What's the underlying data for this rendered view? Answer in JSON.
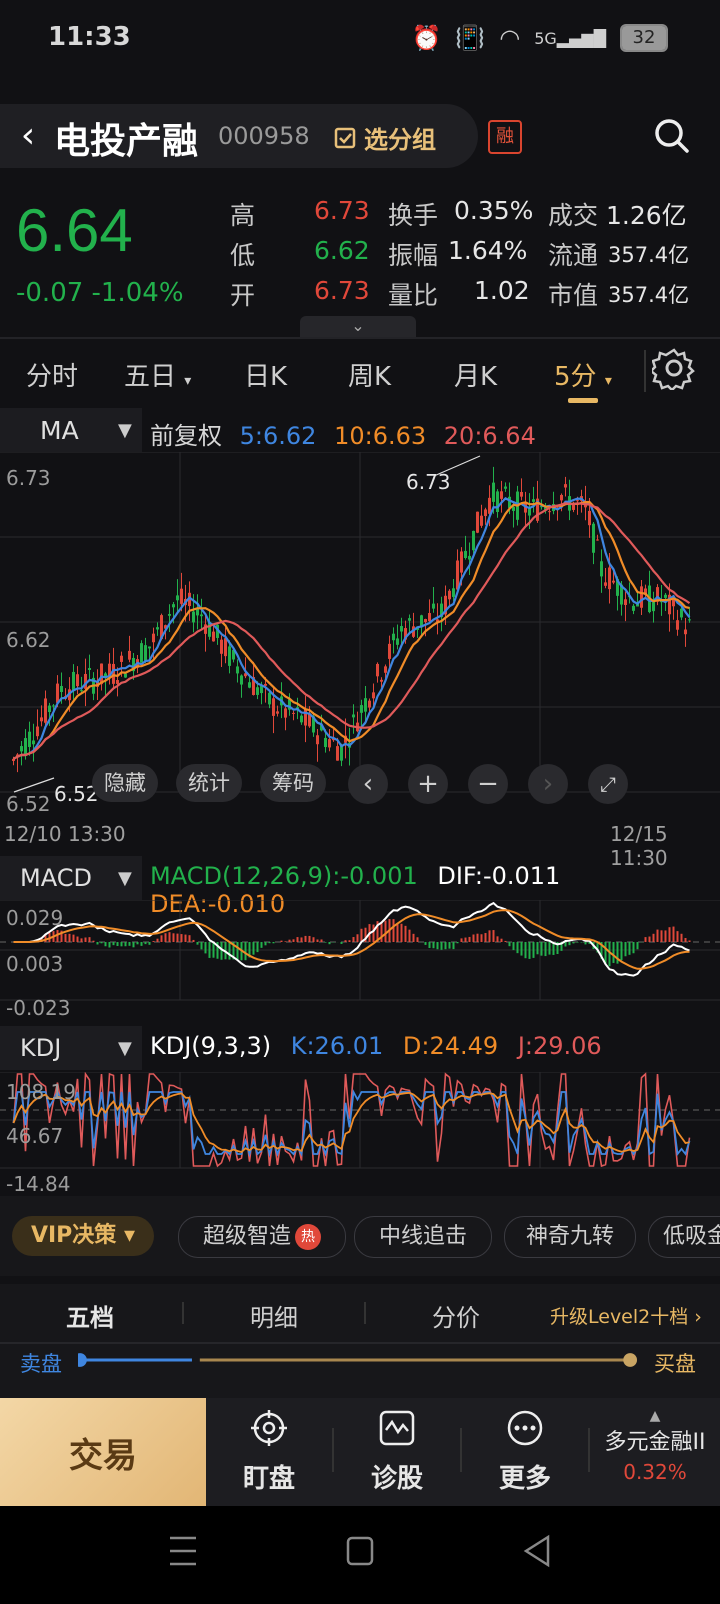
{
  "status_bar": {
    "time": "11:33",
    "network": "5G",
    "battery": "32"
  },
  "header": {
    "back_icon": "back-arrow-icon",
    "name": "电投产融",
    "code": "000958",
    "group_label": "选分组",
    "badge": "融"
  },
  "quote": {
    "price": "6.64",
    "change": "-0.07",
    "change_pct": "-1.04%",
    "rows": [
      [
        {
          "l": "高",
          "v": "6.73",
          "c": "red"
        },
        {
          "l": "换手",
          "v": "0.35%"
        },
        {
          "l": "成交",
          "v": "1.26亿"
        }
      ],
      [
        {
          "l": "低",
          "v": "6.62",
          "c": "green"
        },
        {
          "l": "振幅",
          "v": "1.64%"
        },
        {
          "l": "流通",
          "v": "357.4亿"
        }
      ],
      [
        {
          "l": "开",
          "v": "6.73",
          "c": "red"
        },
        {
          "l": "量比",
          "v": "1.02"
        },
        {
          "l": "市值",
          "v": "357.4亿"
        }
      ]
    ]
  },
  "tabs": [
    "分时",
    "五日",
    "日K",
    "周K",
    "月K",
    "5分"
  ],
  "active_tab": "5分",
  "ma": {
    "selector": "MA",
    "adjust": "前复权",
    "ma5": "5:6.62",
    "ma10": "10:6.63",
    "ma20": "20:6.64"
  },
  "kline": {
    "ymax_label": "6.73",
    "ymid_label": "6.62",
    "ymin_label": "6.52",
    "hi_mark": "6.73",
    "lo_mark": "6.52",
    "start_time": "12/10 13:30",
    "end_time": "12/15 11:30"
  },
  "chart_tools": {
    "hide": "隐藏",
    "stats": "统计",
    "chips": "筹码"
  },
  "macd": {
    "selector": "MACD",
    "title": "MACD(12,26,9):-0.001",
    "dif": "DIF:-0.011",
    "dea": "DEA:-0.010",
    "ymax": "0.029",
    "ymid": "0.003",
    "ymin": "-0.023"
  },
  "kdj": {
    "selector": "KDJ",
    "title": "KDJ(9,3,3)",
    "k": "K:26.01",
    "d": "D:24.49",
    "j": "J:29.06",
    "ymax": "108.19",
    "ymid": "46.67",
    "ymin": "-14.84"
  },
  "features": {
    "vip": "VIP决策",
    "items": [
      "超级智造",
      "中线追击",
      "神奇九转",
      "低吸金"
    ],
    "hot": "热"
  },
  "orderbook": {
    "tabs": [
      "五档",
      "明细",
      "分价"
    ],
    "upgrade": "升级Level2十档",
    "sell": "卖盘",
    "buy": "买盘"
  },
  "bottom": {
    "trade": "交易",
    "nav": [
      "盯盘",
      "诊股",
      "更多"
    ],
    "sector_name": "多元金融II",
    "sector_pct": "0.32%"
  },
  "colors": {
    "up": "#e0483a",
    "down": "#22b14c",
    "ma5": "#3f86e0",
    "ma10": "#f08c28",
    "ma20": "#e05a5a",
    "accent": "#e8b864"
  }
}
